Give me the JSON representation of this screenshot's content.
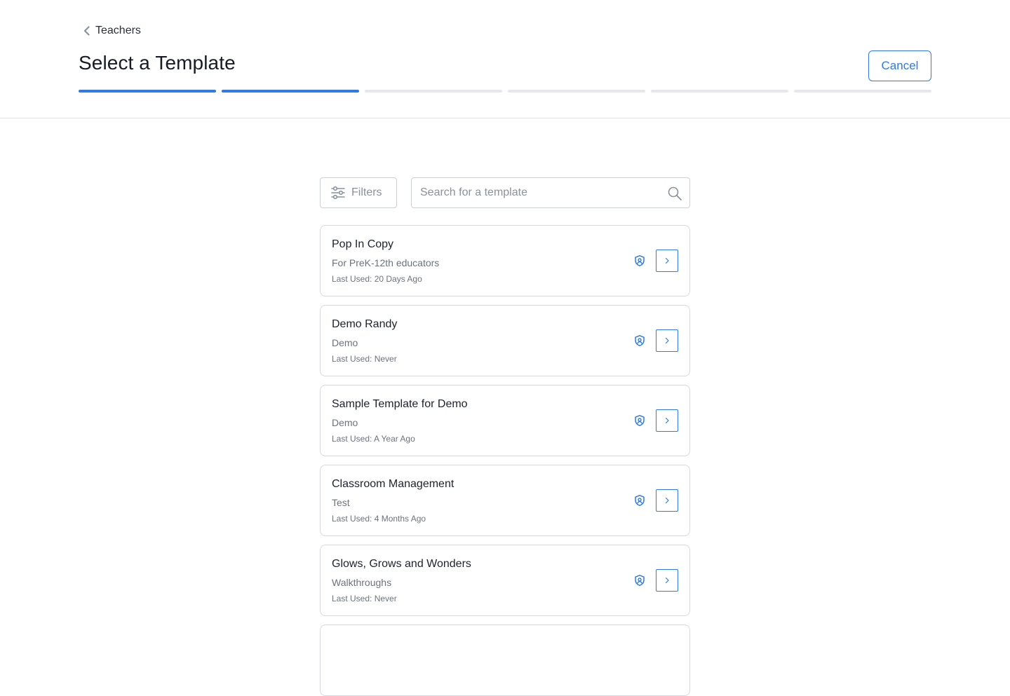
{
  "header": {
    "back_label": "Teachers",
    "title": "Select a Template",
    "cancel_label": "Cancel",
    "steps_total": 6,
    "steps_completed": 2
  },
  "toolbar": {
    "filters_label": "Filters",
    "search_placeholder": "Search for a template",
    "search_value": ""
  },
  "accent_color": "#2f7be0",
  "templates": [
    {
      "title": "Pop In Copy",
      "subtitle": "For PreK-12th educators",
      "last_used": "Last Used: 20 Days Ago"
    },
    {
      "title": "Demo Randy",
      "subtitle": "Demo",
      "last_used": "Last Used: Never"
    },
    {
      "title": "Sample Template for Demo",
      "subtitle": "Demo",
      "last_used": "Last Used: A Year Ago"
    },
    {
      "title": "Classroom Management",
      "subtitle": "Test",
      "last_used": "Last Used: 4 Months Ago"
    },
    {
      "title": "Glows, Grows and Wonders",
      "subtitle": "Walkthroughs",
      "last_used": "Last Used: Never"
    },
    {
      "title": "",
      "subtitle": "",
      "last_used": ""
    }
  ]
}
